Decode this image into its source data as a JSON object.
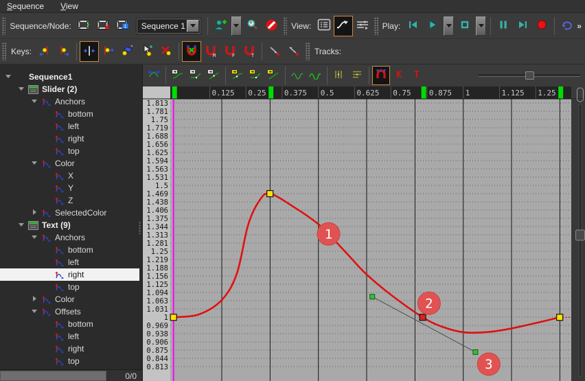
{
  "menu": {
    "items": [
      {
        "label": "Sequence"
      },
      {
        "label": "View"
      }
    ]
  },
  "toolbar_sequence": {
    "label": "Sequence/Node:",
    "sequence_buttons": [
      {
        "name": "add-sequence-button",
        "icon": "film-add"
      },
      {
        "name": "delete-sequence-button",
        "icon": "film-delete"
      },
      {
        "name": "sequence-info-button",
        "icon": "film-info"
      }
    ],
    "combo_value": "Sequence 1",
    "node_buttons": [
      {
        "name": "add-node-button",
        "icon": "person-add"
      },
      {
        "name": "node-dropdown-button",
        "icon": "dropdown"
      },
      {
        "name": "pick-node-button",
        "icon": "magnifier"
      },
      {
        "name": "clear-node-button",
        "icon": "block"
      }
    ],
    "view_label": "View:",
    "view_buttons": [
      {
        "name": "view-list-button",
        "icon": "view-list",
        "selected": false
      },
      {
        "name": "view-curves-button",
        "icon": "view-curves",
        "selected": true
      },
      {
        "name": "view-dopesheet-button",
        "icon": "view-dopesheet",
        "selected": false
      }
    ],
    "play_label": "Play:",
    "play_buttons": [
      {
        "name": "skip-start-button",
        "icon": "skip-start"
      },
      {
        "name": "play-button",
        "icon": "play"
      },
      {
        "name": "play-dropdown-button",
        "icon": "dropdown"
      },
      {
        "name": "stop-button",
        "icon": "stop"
      },
      {
        "name": "stop-dropdown-button",
        "icon": "dropdown"
      },
      {
        "name": "separator",
        "icon": "sep"
      },
      {
        "name": "pause-button",
        "icon": "pause"
      },
      {
        "name": "skip-end-button",
        "icon": "skip-end"
      },
      {
        "name": "record-button",
        "icon": "record"
      },
      {
        "name": "separator",
        "icon": "sep"
      },
      {
        "name": "loop-button",
        "icon": "loop"
      }
    ],
    "overflow_label": "»"
  },
  "toolbar_keys": {
    "label": "Keys:",
    "buttons": [
      {
        "name": "prev-key-button",
        "icon": "key-prev"
      },
      {
        "name": "next-key-button",
        "icon": "key-next"
      },
      {
        "name": "separator",
        "icon": "sep"
      },
      {
        "name": "add-key-button",
        "icon": "key-add",
        "selected": true
      },
      {
        "name": "set-key-button",
        "icon": "key-set"
      },
      {
        "name": "key-brush-button",
        "icon": "key-brush"
      },
      {
        "name": "select-add-key-button",
        "icon": "key-select"
      },
      {
        "name": "delete-key-button",
        "icon": "key-delete"
      },
      {
        "name": "separator",
        "icon": "sep"
      },
      {
        "name": "snap-off-button",
        "icon": "magnet-x",
        "selected": true
      },
      {
        "name": "snap-markers-button",
        "icon": "magnet-m"
      },
      {
        "name": "snap-frames-button",
        "icon": "magnet-f"
      },
      {
        "name": "snap-time-button",
        "icon": "magnet-t"
      },
      {
        "name": "separator",
        "icon": "sep"
      },
      {
        "name": "ease-in-button",
        "icon": "ease-down"
      },
      {
        "name": "ease-out-button",
        "icon": "ease-up"
      }
    ],
    "tracks_label": "Tracks:"
  },
  "curve_toolbar": {
    "buttons": [
      {
        "name": "show-tangents-button",
        "icon": "tangents"
      },
      {
        "name": "separator",
        "icon": "sep"
      },
      {
        "name": "auto-tangent-button",
        "icon": "curve-ease-gray"
      },
      {
        "name": "smooth-tangent-button",
        "icon": "curve-corner-gray"
      },
      {
        "name": "linear-tangent-button",
        "icon": "curve-linear-gray"
      },
      {
        "name": "separator",
        "icon": "sep"
      },
      {
        "name": "key-ease-button",
        "icon": "curve-ease-yellow"
      },
      {
        "name": "key-corner-button",
        "icon": "curve-corner-yellow"
      },
      {
        "name": "key-linear-button",
        "icon": "curve-linear-yellow"
      },
      {
        "name": "separator",
        "icon": "sep"
      },
      {
        "name": "pre-infinity-button",
        "icon": "sine1"
      },
      {
        "name": "post-infinity-button",
        "icon": "sine2"
      },
      {
        "name": "separator",
        "icon": "sep"
      },
      {
        "name": "fit-horizontal-button",
        "icon": "bars-v"
      },
      {
        "name": "fit-vertical-button",
        "icon": "bars-h"
      },
      {
        "name": "separator",
        "icon": "sep"
      },
      {
        "name": "snap-curve-button",
        "icon": "magnet-snap",
        "selected": true
      },
      {
        "name": "show-keys-button",
        "icon": "letter-k"
      },
      {
        "name": "show-tangents-t-button",
        "icon": "letter-t"
      }
    ]
  },
  "tree": {
    "items": [
      {
        "label": "Sequence1",
        "depth": 0,
        "expander": "down",
        "icon": "none",
        "bold": true
      },
      {
        "label": "Slider (2)",
        "depth": 1,
        "expander": "down",
        "icon": "node",
        "bold": true
      },
      {
        "label": "Anchors",
        "depth": 2,
        "expander": "down",
        "icon": "track"
      },
      {
        "label": "bottom",
        "depth": 3,
        "expander": "none",
        "icon": "track"
      },
      {
        "label": "left",
        "depth": 3,
        "expander": "none",
        "icon": "track"
      },
      {
        "label": "right",
        "depth": 3,
        "expander": "none",
        "icon": "track"
      },
      {
        "label": "top",
        "depth": 3,
        "expander": "none",
        "icon": "track"
      },
      {
        "label": "Color",
        "depth": 2,
        "expander": "down",
        "icon": "track"
      },
      {
        "label": "X",
        "depth": 3,
        "expander": "none",
        "icon": "track"
      },
      {
        "label": "Y",
        "depth": 3,
        "expander": "none",
        "icon": "track"
      },
      {
        "label": "Z",
        "depth": 3,
        "expander": "none",
        "icon": "track"
      },
      {
        "label": "SelectedColor",
        "depth": 2,
        "expander": "right",
        "icon": "track"
      },
      {
        "label": "Text (9)",
        "depth": 1,
        "expander": "down",
        "icon": "node",
        "bold": true
      },
      {
        "label": "Anchors",
        "depth": 2,
        "expander": "down",
        "icon": "track"
      },
      {
        "label": "bottom",
        "depth": 3,
        "expander": "none",
        "icon": "track"
      },
      {
        "label": "left",
        "depth": 3,
        "expander": "none",
        "icon": "track"
      },
      {
        "label": "right",
        "depth": 3,
        "expander": "none",
        "icon": "track",
        "selected": true
      },
      {
        "label": "top",
        "depth": 3,
        "expander": "none",
        "icon": "track"
      },
      {
        "label": "Color",
        "depth": 2,
        "expander": "right",
        "icon": "track"
      },
      {
        "label": "Offsets",
        "depth": 2,
        "expander": "down",
        "icon": "track"
      },
      {
        "label": "bottom",
        "depth": 3,
        "expander": "none",
        "icon": "track"
      },
      {
        "label": "left",
        "depth": 3,
        "expander": "none",
        "icon": "track"
      },
      {
        "label": "right",
        "depth": 3,
        "expander": "none",
        "icon": "track"
      },
      {
        "label": "top",
        "depth": 3,
        "expander": "none",
        "icon": "track"
      }
    ],
    "footer_counter": "0/0"
  },
  "chart_data": {
    "type": "line",
    "x_tick_labels": [
      "0.125",
      "0.25",
      "0.375",
      "0.5",
      "0.625",
      "0.75",
      "0.875",
      "1",
      "1.125",
      "1.25"
    ],
    "x_tick_values": [
      0.125,
      0.25,
      0.375,
      0.5,
      0.625,
      0.75,
      0.875,
      1,
      1.125,
      1.25
    ],
    "y_tick_labels": [
      "1.813",
      "1.781",
      "1.75",
      "1.719",
      "1.688",
      "1.656",
      "1.625",
      "1.594",
      "1.563",
      "1.531",
      "1.5",
      "1.469",
      "1.438",
      "1.406",
      "1.375",
      "1.344",
      "1.313",
      "1.281",
      "1.25",
      "1.219",
      "1.188",
      "1.156",
      "1.125",
      "1.094",
      "1.063",
      "1.031",
      "1",
      "0.969",
      "0.938",
      "0.906",
      "0.875",
      "0.844",
      "0.813"
    ],
    "y_top": 1.813,
    "y_step": 0.03125,
    "grid_x_step": 0.16667,
    "grid_x_count": 8,
    "playhead_t": 0,
    "keyframes": [
      {
        "t": 0.0,
        "v": 1.0,
        "selected": false
      },
      {
        "t": 0.333,
        "v": 1.469,
        "selected": false
      },
      {
        "t": 0.86,
        "v": 1.0,
        "selected": true
      },
      {
        "t": 1.333,
        "v": 1.0,
        "selected": false
      }
    ],
    "ruler_key_markers": [
      0.0,
      0.333,
      0.86,
      1.333
    ],
    "selected_key_tangents": [
      {
        "t": 0.686,
        "v": 1.078
      },
      {
        "t": 1.042,
        "v": 0.868
      }
    ],
    "curve_samples": [
      [
        0.0,
        1.0
      ],
      [
        0.088,
        1.011
      ],
      [
        0.167,
        1.066
      ],
      [
        0.219,
        1.167
      ],
      [
        0.257,
        1.349
      ],
      [
        0.295,
        1.44
      ],
      [
        0.333,
        1.469
      ],
      [
        0.42,
        1.415
      ],
      [
        0.496,
        1.357
      ],
      [
        0.535,
        1.316
      ],
      [
        0.6,
        1.24
      ],
      [
        0.664,
        1.165
      ],
      [
        0.752,
        1.084
      ],
      [
        0.86,
        1.0
      ],
      [
        0.93,
        0.963
      ],
      [
        1.003,
        0.943
      ],
      [
        1.084,
        0.944
      ],
      [
        1.163,
        0.957
      ],
      [
        1.249,
        0.978
      ],
      [
        1.333,
        1.0
      ]
    ],
    "annotations": [
      {
        "label": "1",
        "t": 0.535,
        "v": 1.316
      },
      {
        "label": "2",
        "t": 0.882,
        "v": 1.053
      },
      {
        "label": "3",
        "t": 1.088,
        "v": 0.822
      }
    ],
    "colors": {
      "curve": "#e01010",
      "key": "#ffe000",
      "key_selected": "#dd2020",
      "handle": "#33bd33",
      "marker": "#00dd00",
      "playhead": "#ff00ff",
      "badge": "#e15352",
      "accent": "#cf8a3b"
    }
  }
}
